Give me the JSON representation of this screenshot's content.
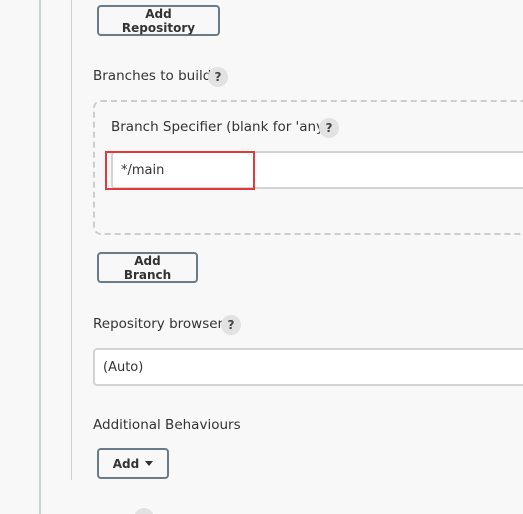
{
  "repositories": {
    "add_repository_label": "Add Repository"
  },
  "branches": {
    "section_label": "Branches to build",
    "help_label": "?",
    "specifier_label": "Branch Specifier (blank for 'any')",
    "specifier_help_label": "?",
    "specifier_value": "*/main",
    "add_branch_label": "Add Branch"
  },
  "repository_browser": {
    "label": "Repository browser",
    "help_label": "?",
    "selected_value": "(Auto)"
  },
  "additional_behaviours": {
    "label": "Additional Behaviours",
    "add_label": "Add"
  },
  "colors": {
    "highlight": "#e03a3a",
    "button_border": "#6b7a87"
  }
}
